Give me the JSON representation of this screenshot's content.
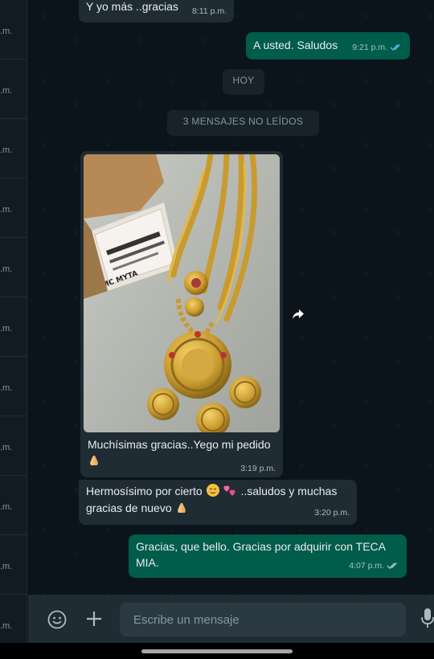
{
  "sidebar": {
    "times": [
      ".m.",
      ".m.",
      ".m.",
      ".m.",
      ".m.",
      ".m.",
      ".m.",
      ".m.",
      ".m.",
      ".m.",
      ".m."
    ]
  },
  "messages": {
    "m1": {
      "text": "Y yo más  ..gracias",
      "time": "8:11 p.m."
    },
    "m2": {
      "text": "A usted. Saludos",
      "time": "9:21 p.m."
    },
    "m3": {
      "caption": "Muchísimas gracias..Yego mi pedido",
      "time": "3:19 p.m."
    },
    "m4": {
      "text_before": "Hermosísimo por cierto",
      "text_after": "..saludos y muchas gracias de nuevo",
      "time": "3:20 p.m."
    },
    "m5": {
      "text": "Gracias,  que bello. Gracias por adquirir con TECA MIA.",
      "time": "4:07 p.m."
    }
  },
  "separators": {
    "day": "HOY",
    "unread": "3 MENSAJES NO LEÍDOS"
  },
  "photo": {
    "box_label": "MC MYTA"
  },
  "composer": {
    "placeholder": "Escribe un mensaje"
  },
  "colors": {
    "background": "#0b141a",
    "incoming": "#202c33",
    "outgoing": "#005c4b",
    "read_ticks": "#53bdeb"
  }
}
